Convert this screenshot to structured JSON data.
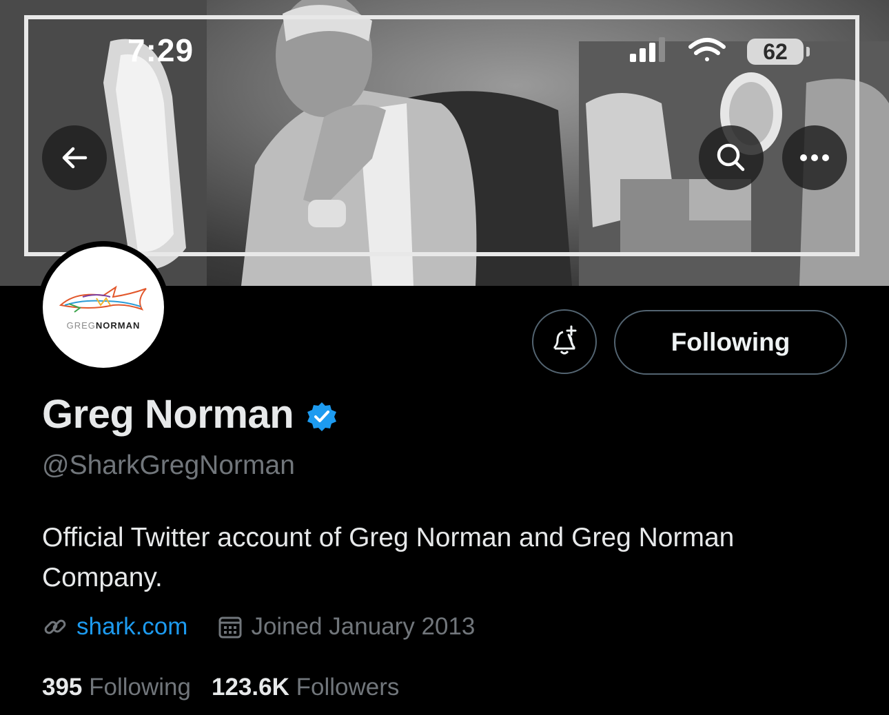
{
  "status_bar": {
    "time": "7:29",
    "battery": "62"
  },
  "profile": {
    "name": "Greg Norman",
    "handle": "@SharkGregNorman",
    "bio": "Official Twitter account of Greg Norman and Greg Norman Company.",
    "website": "shark.com",
    "joined": "Joined January 2013",
    "following_count": "395",
    "following_label": "Following",
    "followers_count": "123.6K",
    "followers_label": "Followers",
    "avatar_logo": {
      "bold": "NORMAN",
      "light": "GREG"
    }
  },
  "actions": {
    "follow_state_label": "Following"
  },
  "colors": {
    "accent": "#1d9bf0",
    "verified": "#1d9bf0",
    "background": "#000000",
    "muted": "#71767b"
  },
  "icons": [
    "back-arrow-icon",
    "search-icon",
    "more-icon",
    "bell-plus-icon",
    "verified-badge-icon",
    "link-icon",
    "calendar-icon",
    "cellular-signal-icon",
    "wifi-icon",
    "battery-icon"
  ]
}
